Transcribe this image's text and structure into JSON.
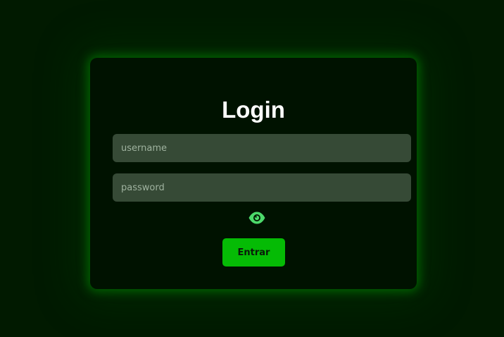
{
  "login": {
    "title": "Login",
    "username_placeholder": "username",
    "username_value": "",
    "password_placeholder": "password",
    "password_value": "",
    "toggle_icon": "eye-icon",
    "submit_label": "Entrar"
  },
  "colors": {
    "background": "#011a00",
    "card": "#001200",
    "glow": "#009600",
    "field": "#364a36",
    "accent": "#05bb05",
    "eye": "#4cd96a"
  }
}
